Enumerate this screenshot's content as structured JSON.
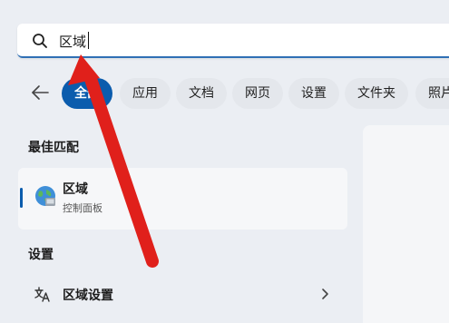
{
  "search": {
    "query": "区域"
  },
  "filters": [
    {
      "label": "全部",
      "active": true
    },
    {
      "label": "应用"
    },
    {
      "label": "文档"
    },
    {
      "label": "网页"
    },
    {
      "label": "设置"
    },
    {
      "label": "文件夹"
    },
    {
      "label": "照片"
    }
  ],
  "best_match": {
    "section_title": "最佳匹配",
    "title": "区域",
    "subtitle": "控制面板",
    "icon": "globe-icon"
  },
  "settings": {
    "section_title": "设置",
    "items": [
      {
        "label": "区域设置",
        "icon": "region-settings-icon"
      }
    ]
  },
  "colors": {
    "accent": "#0b5cad",
    "annotation_arrow": "#e0201b"
  }
}
